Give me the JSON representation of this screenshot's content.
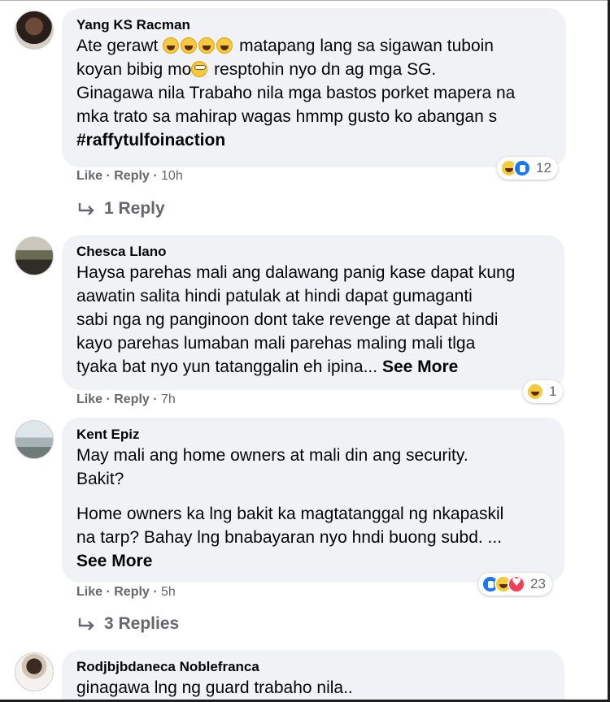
{
  "comments": [
    {
      "author": "Yang KS Racman",
      "text_lines": [
        "Ate gerawt",
        "matapang lang sa sigawan tuboin",
        "koyan bibig mo",
        "resptohin nyo dn ag mga SG.",
        "Ginagawa nila Trabaho nila mga bastos porket mapera na",
        "mka trato sa mahirap wagas hmmp gusto ko abangan s",
        "#raffytulfoinaction"
      ],
      "actions": {
        "like": "Like",
        "reply": "Reply",
        "time": "10h"
      },
      "reactions": {
        "icons": [
          "haha-icon",
          "like-icon"
        ],
        "count": "12"
      },
      "replies": "1 Reply"
    },
    {
      "author": "Chesca Llano",
      "text_lines": [
        "Haysa parehas mali ang dalawang panig kase dapat kung",
        "aawatin salita hindi patulak at hindi dapat gumaganti",
        "sabi nga ng panginoon dont take revenge at dapat hindi",
        "kayo parehas lumaban mali parehas maling mali tlga",
        "tyaka bat nyo yun tatanggalin eh ipina..."
      ],
      "see_more": "See More",
      "actions": {
        "like": "Like",
        "reply": "Reply",
        "time": "7h"
      },
      "reactions": {
        "icons": [
          "haha-icon"
        ],
        "count": "1"
      }
    },
    {
      "author": "Kent Epiz",
      "text_lines": [
        "May mali ang home owners at mali din ang security.",
        "Bakit?",
        "Home owners ka lng bakit ka magtatanggal ng nkapaskil",
        "na tarp? Bahay lng bnabayaran nyo hndi buong subd. ..."
      ],
      "see_more": "See More",
      "actions": {
        "like": "Like",
        "reply": "Reply",
        "time": "5h"
      },
      "reactions": {
        "icons": [
          "like-icon",
          "haha-icon",
          "love-icon"
        ],
        "count": "23"
      },
      "replies": "3 Replies"
    },
    {
      "author": "Rodjbjbdaneca Noblefranca",
      "text_lines": [
        "ginagawa lng ng guard trabaho nila.."
      ]
    }
  ],
  "colors": {
    "bubble": "#f0f2f5",
    "meta": "#65676b",
    "like_blue": "#1877f2",
    "haha_yellow": "#f7c93d",
    "love_red": "#f33e58"
  }
}
